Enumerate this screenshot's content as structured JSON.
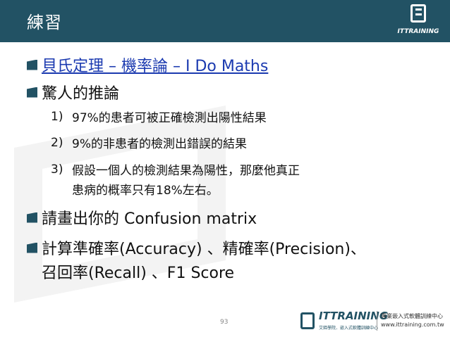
{
  "header": {
    "title": "練習",
    "logo_text": "ITTRAINING"
  },
  "bullets": [
    {
      "text": "貝氏定理 – 機率論 – I Do Maths",
      "is_link": true
    },
    {
      "text": "驚人的推論",
      "is_link": false
    }
  ],
  "inference": [
    {
      "num": "1)",
      "text": "97%的患者可被正確檢測出陽性結果"
    },
    {
      "num": "2)",
      "text": "9%的非患者的檢測出錯誤的結果"
    },
    {
      "num": "3)",
      "text": "假設一個人的檢測結果為陽性，那麼他真正",
      "text2": "患病的概率只有18%左右。"
    }
  ],
  "bullets_after": [
    {
      "text": "請畫出你的 Confusion matrix"
    },
    {
      "text": "計算準確率(Accuracy) 、精確率(Precision)、",
      "text2": "召回率(Recall) 、F1 Score"
    }
  ],
  "footer": {
    "page_number": "93",
    "brand": "ITTRAINING",
    "brand_sub": "艾鍗學院．嵌入式軟體訓練中心",
    "cn_desc": "專業嵌入式軟體訓練中心",
    "url": "www.ittraining.com.tw"
  },
  "colors": {
    "header_bg": "#225264",
    "link": "#1b3ab0"
  }
}
